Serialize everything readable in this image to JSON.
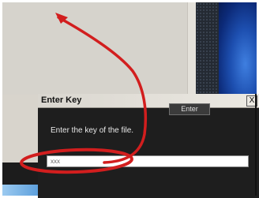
{
  "dialog": {
    "title": "Enter Key",
    "close_label": "X",
    "message": "Enter the key of the file.",
    "input_value": "xxx",
    "enter_label": "Enter"
  },
  "annotation": {
    "color": "#d21e1e"
  },
  "icons": {
    "close": "close-icon",
    "arrow": "arrow-annotation",
    "circle": "circle-annotation"
  }
}
